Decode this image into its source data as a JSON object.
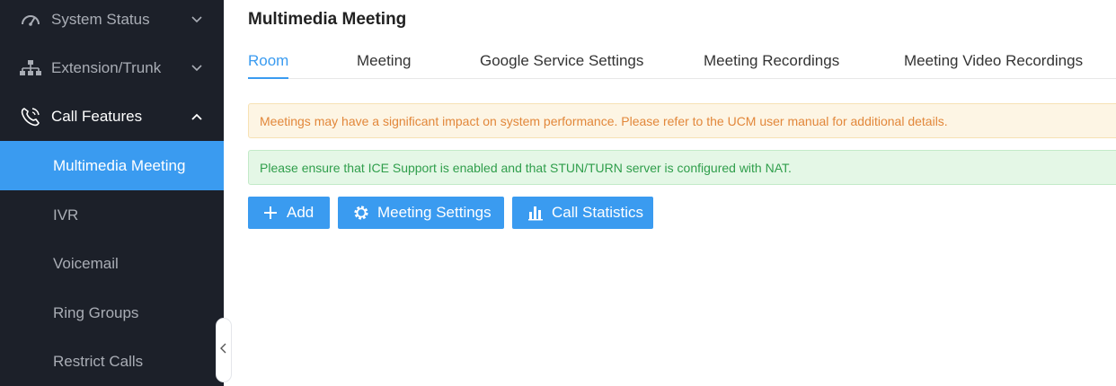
{
  "sidebar": {
    "groups": [
      {
        "label": "System Status",
        "icon": "speedometer-icon"
      },
      {
        "label": "Extension/Trunk",
        "icon": "network-icon"
      },
      {
        "label": "Call Features",
        "icon": "phone-icon"
      }
    ],
    "items": [
      {
        "label": "Multimedia Meeting",
        "active": true
      },
      {
        "label": "IVR"
      },
      {
        "label": "Voicemail"
      },
      {
        "label": "Ring Groups"
      },
      {
        "label": "Restrict Calls"
      }
    ]
  },
  "main": {
    "title": "Multimedia Meeting",
    "tabs": [
      {
        "label": "Room",
        "active": true
      },
      {
        "label": "Meeting"
      },
      {
        "label": "Google Service Settings"
      },
      {
        "label": "Meeting Recordings"
      },
      {
        "label": "Meeting Video Recordings"
      }
    ],
    "alerts": {
      "warning": "Meetings may have a significant impact on system performance. Please refer to the UCM user manual for additional details.",
      "info": "Please ensure that ICE Support is enabled and that STUN/TURN server is configured with NAT."
    },
    "buttons": {
      "add": "Add",
      "meeting_settings": "Meeting Settings",
      "call_statistics": "Call Statistics"
    }
  },
  "colors": {
    "accent": "#3a9bf0",
    "sidebar_bg": "#1c2029",
    "warning_text": "#e2873a",
    "success_text": "#2f9e4b"
  }
}
